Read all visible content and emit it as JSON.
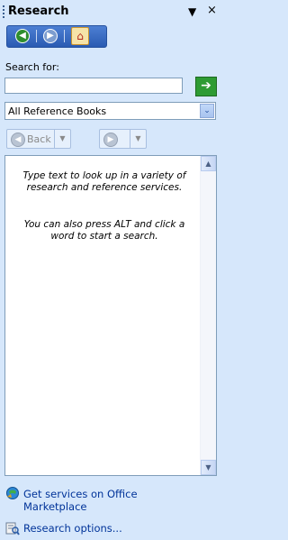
{
  "pane": {
    "title": "Research",
    "dropdown_glyph": "▼",
    "close_glyph": "×"
  },
  "nav": {
    "back_icon": "nav-back-icon",
    "forward_icon": "nav-forward-icon",
    "home_icon": "home-icon",
    "back_glyph": "◀",
    "forward_glyph": "▶",
    "home_glyph": "⌂"
  },
  "search": {
    "label": "Search for:",
    "value": "",
    "placeholder": "",
    "go_glyph": "➔"
  },
  "reference": {
    "selected": "All Reference Books",
    "arrow_glyph": "⌄"
  },
  "history": {
    "back_label": "Back",
    "dropdown_glyph": "▼",
    "forward_glyph": "▶",
    "back_glyph": "◀"
  },
  "results": {
    "message_1": "Type text to look up in a variety of research and reference services.",
    "message_2": "You can also press ALT and click a word to start a search.",
    "scroll_up_glyph": "▲",
    "scroll_down_glyph": "▼"
  },
  "footer": {
    "services_link": "Get services on Office Marketplace",
    "options_link": "Research options..."
  },
  "colors": {
    "pane_bg": "#d6e7fb",
    "nav_blue": "#2a5bb2",
    "go_green": "#2e9b33",
    "link_blue": "#003399"
  }
}
